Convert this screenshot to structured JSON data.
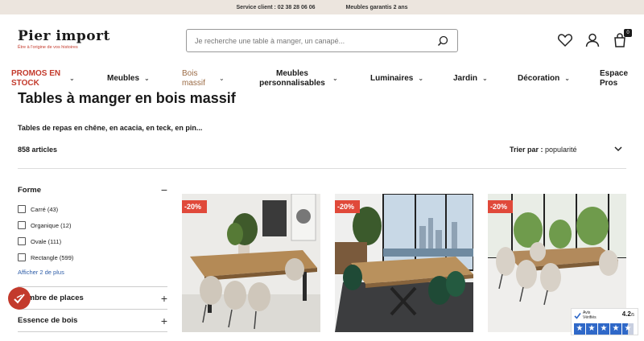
{
  "topbar": {
    "service": "Service client : 02 38 28 06 06",
    "guarantee": "Meubles garantis 2 ans"
  },
  "header": {
    "logo": "Pier import",
    "tagline": "Être à l'origine de vos histoires",
    "search_placeholder": "Je recherche une table à manger, un canapé...",
    "cart_count": "0"
  },
  "nav": [
    {
      "label": "PROMOS EN STOCK",
      "style": "red"
    },
    {
      "label": "Meubles",
      "style": "normal"
    },
    {
      "label": "Bois massif",
      "style": "brown"
    },
    {
      "label": "Meubles personnalisables",
      "style": "normal"
    },
    {
      "label": "Luminaires",
      "style": "normal"
    },
    {
      "label": "Jardin",
      "style": "normal"
    },
    {
      "label": "Décoration",
      "style": "normal"
    },
    {
      "label": "Espace Pros",
      "style": "normal"
    }
  ],
  "page": {
    "title": "Tables à manger en bois massif",
    "subtitle": "Tables de repas en chêne, en acacia, en teck, en pin...",
    "count": "858 articles",
    "sort_label": "Trier par :",
    "sort_value": "popularité"
  },
  "filters": {
    "forme": {
      "title": "Forme",
      "options": [
        "Carré (43)",
        "Organique (12)",
        "Ovale (111)",
        "Rectangle (599)"
      ],
      "more": "Afficher 2 de plus"
    },
    "places": "Nombre de places",
    "essence": "Essence de bois"
  },
  "products": [
    {
      "discount": "-20%"
    },
    {
      "discount": "-20%"
    },
    {
      "discount": "-20%"
    }
  ],
  "avis": {
    "brand_line1": "Avis",
    "brand_line2": "Vérifiés",
    "score": "4.2",
    "score_max": "/5",
    "rating": 4.2
  },
  "colors": {
    "accent": "#c33a2c",
    "topbar_bg": "#ece5de",
    "brown": "#9b6b45",
    "discount": "#e0493a",
    "avis_blue": "#2f68c8"
  }
}
